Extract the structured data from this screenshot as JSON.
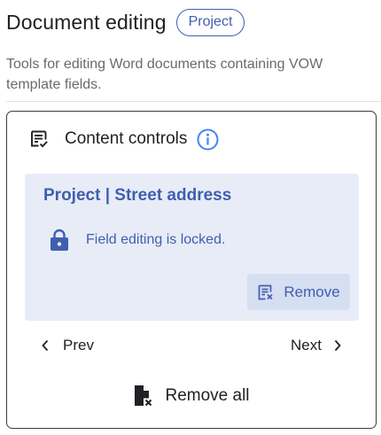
{
  "header": {
    "title": "Document editing",
    "chip_label": "Project"
  },
  "description": "Tools for editing Word documents containing VOW template fields.",
  "card": {
    "title": "Content controls",
    "field": {
      "title": "Project | Street address",
      "lock_message": "Field editing is locked.",
      "remove_label": "Remove"
    },
    "nav": {
      "prev_label": "Prev",
      "next_label": "Next"
    },
    "remove_all_label": "Remove all"
  },
  "icons": {
    "card_title_icon": "checklist-icon",
    "info": "info-icon",
    "lock": "lock-icon",
    "remove": "remove-field-icon",
    "prev": "chevron-left-icon",
    "next": "chevron-right-icon",
    "remove_all": "file-remove-icon"
  },
  "colors": {
    "accent": "#3f5fb0",
    "info_blue": "#4285f4",
    "field_bg": "#e8ecf7",
    "remove_button_bg": "#d6def1",
    "text": "#202124",
    "muted_text": "#6a6a6a"
  }
}
